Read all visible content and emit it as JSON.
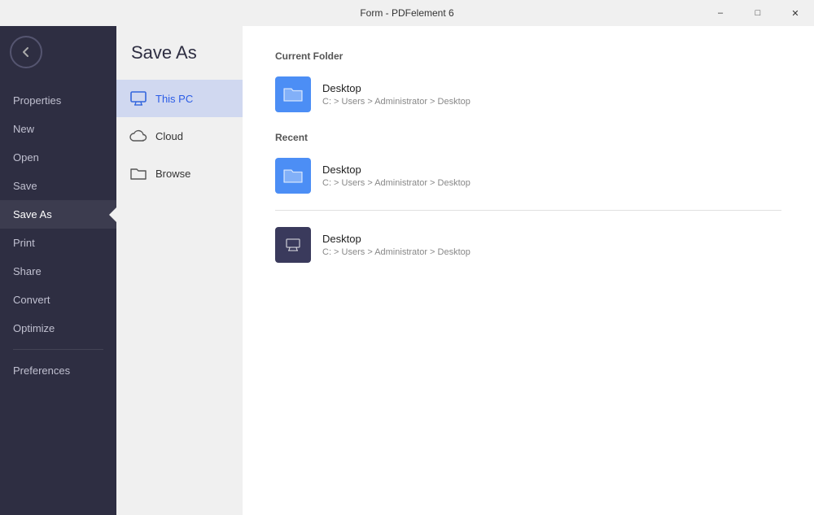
{
  "window": {
    "title": "Form - PDFelement 6",
    "controls": {
      "minimize": "–",
      "maximize": "□",
      "close": "✕"
    }
  },
  "sidebar": {
    "items": [
      {
        "id": "properties",
        "label": "Properties"
      },
      {
        "id": "new",
        "label": "New"
      },
      {
        "id": "open",
        "label": "Open"
      },
      {
        "id": "save",
        "label": "Save"
      },
      {
        "id": "save-as",
        "label": "Save As",
        "active": true
      },
      {
        "id": "print",
        "label": "Print"
      },
      {
        "id": "share",
        "label": "Share"
      },
      {
        "id": "convert",
        "label": "Convert"
      },
      {
        "id": "optimize",
        "label": "Optimize"
      },
      {
        "id": "preferences",
        "label": "Preferences"
      }
    ]
  },
  "middle": {
    "title": "Save As",
    "items": [
      {
        "id": "this-pc",
        "label": "This PC",
        "icon": "monitor",
        "active": true
      },
      {
        "id": "cloud",
        "label": "Cloud",
        "icon": "cloud"
      },
      {
        "id": "browse",
        "label": "Browse",
        "icon": "folder"
      }
    ]
  },
  "main": {
    "current_folder_label": "Current Folder",
    "recent_label": "Recent",
    "current_folder": {
      "name": "Desktop",
      "path": "C: > Users > Administrator > Desktop",
      "icon_type": "blue"
    },
    "recent_items": [
      {
        "name": "Desktop",
        "path": "C: > Users > Administrator > Desktop",
        "icon_type": "blue"
      },
      {
        "name": "Desktop",
        "path": "C: > Users > Administrator > Desktop",
        "icon_type": "dark"
      }
    ]
  }
}
